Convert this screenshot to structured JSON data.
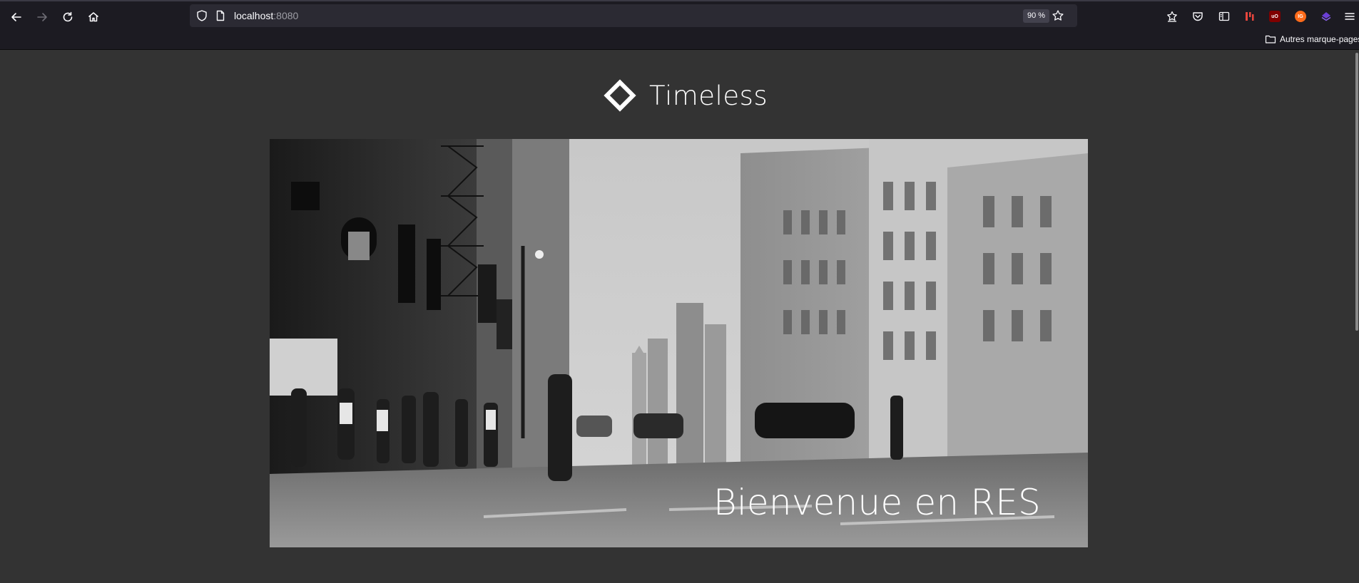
{
  "browser": {
    "url_host": "localhost",
    "url_port": ":8080",
    "zoom": "90 %",
    "bookmarks_folder_label": "Autres marque-pages",
    "nav_icons": [
      "back-icon",
      "forward-icon",
      "reload-icon",
      "home-icon"
    ],
    "toolbar_icons": [
      "save-to-pocket-icon",
      "pocket-icon",
      "sidebar-icon",
      "extension-icon",
      "ublock-icon",
      "extension-badge-icon",
      "extension-icon-purple",
      "menu-icon"
    ],
    "colors": {
      "toolbar_bg": "#1c1b22",
      "urlbar_bg": "#2b2a33",
      "page_bg": "#333333"
    }
  },
  "site": {
    "logo_icon": "diamond-outline-icon",
    "brand_name": "Timeless",
    "hero": {
      "image": "black-and-white-city-street-photo",
      "caption": "Bienvenue en RES"
    }
  }
}
